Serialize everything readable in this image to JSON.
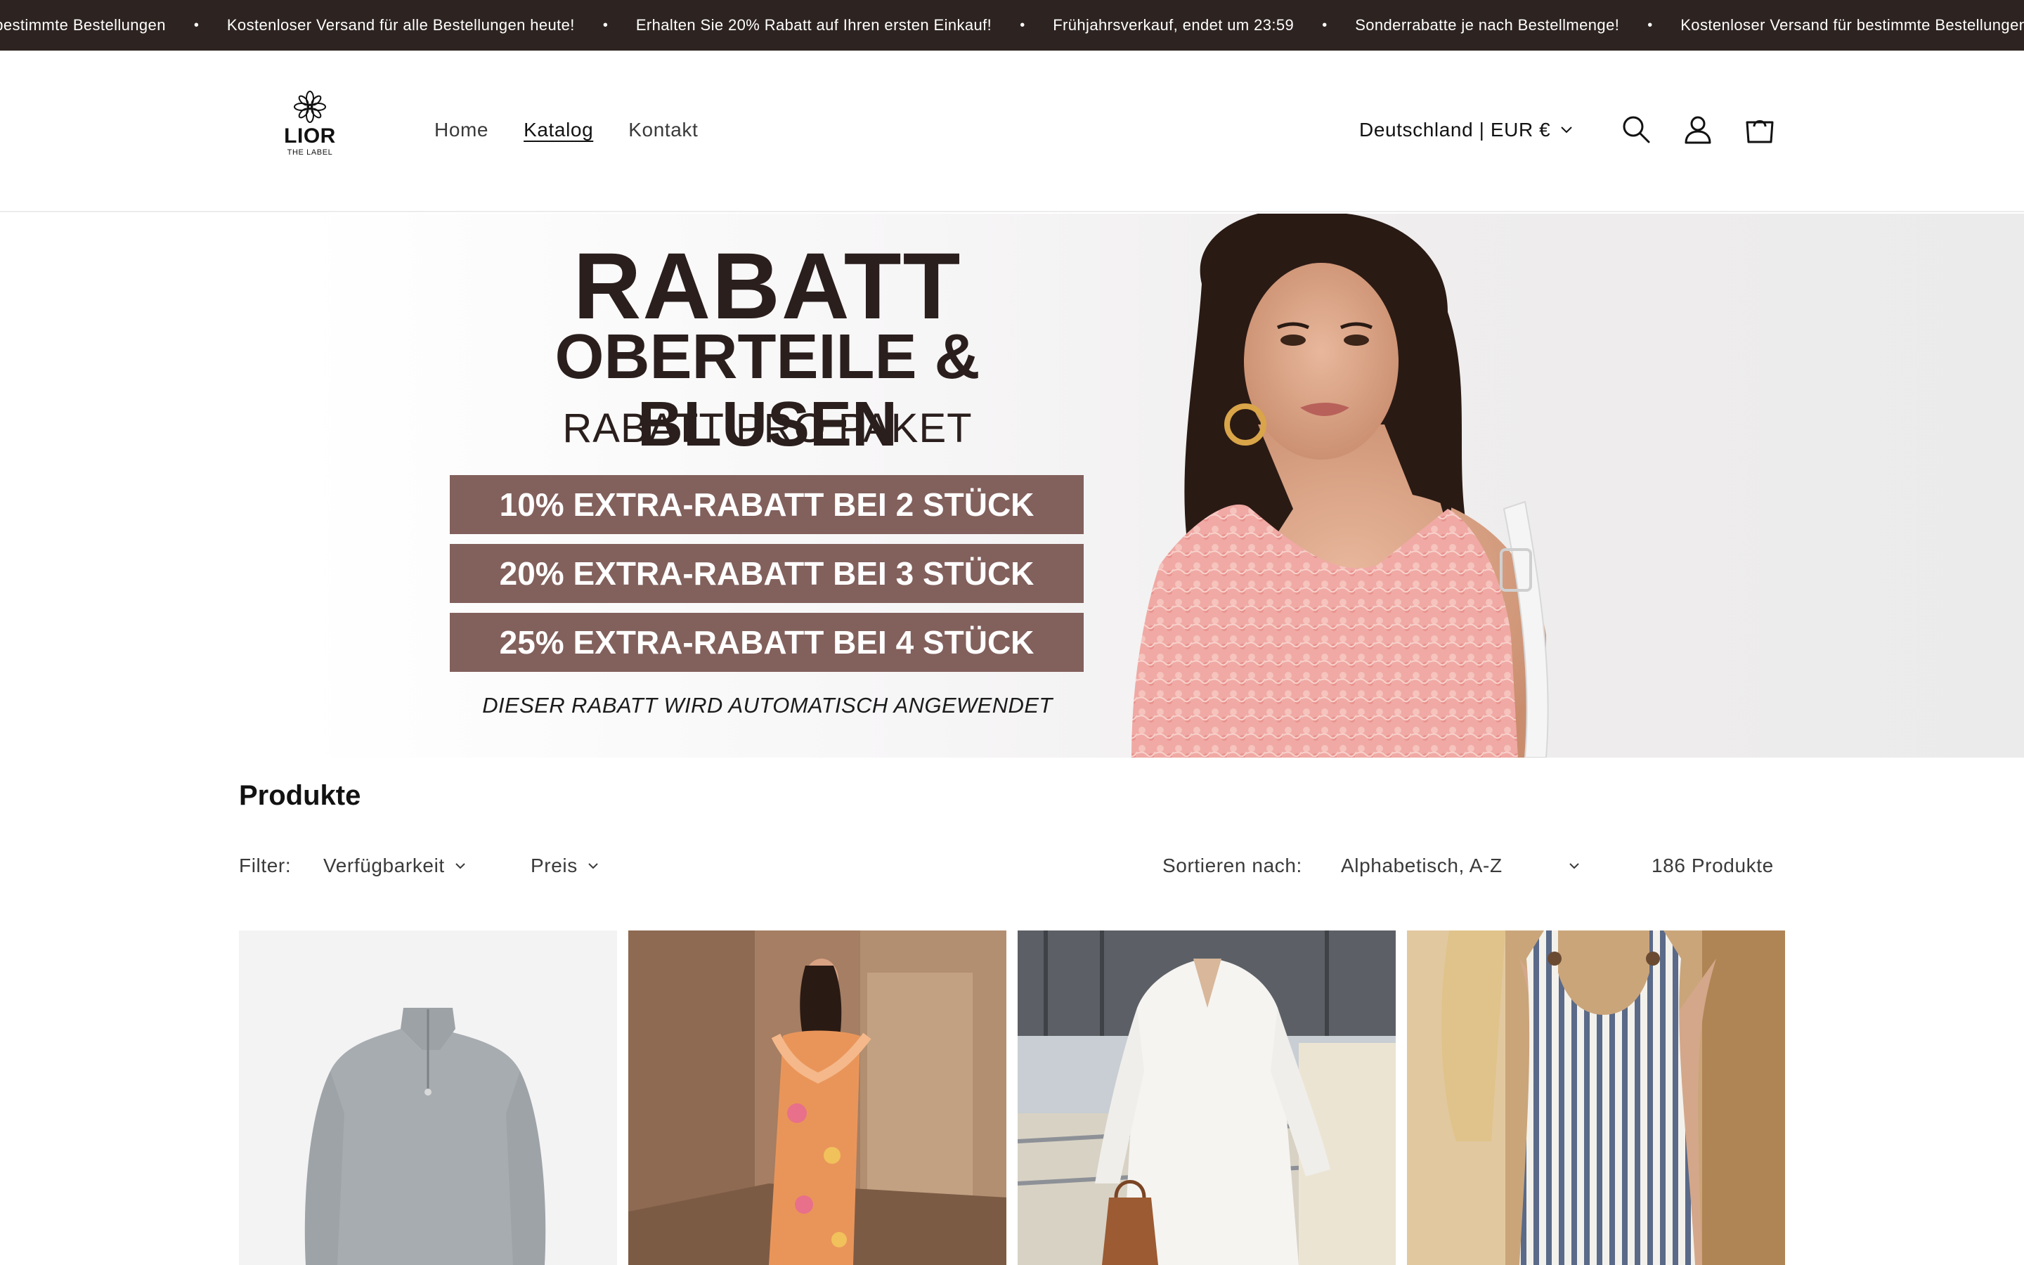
{
  "announcement": {
    "items": [
      "r bestimmte Bestellungen",
      "Kostenloser Versand für alle Bestellungen heute!",
      "Erhalten Sie 20% Rabatt auf Ihren ersten Einkauf!",
      "Frühjahrsverkauf, endet um 23:59",
      "Sonderrabatte je nach Bestellmenge!",
      "Kostenloser Versand für bestimmte Bestellungen"
    ],
    "separator": "•",
    "background": "#2d2421"
  },
  "header": {
    "logo": {
      "main": "LIOR",
      "sub": "THE LABEL",
      "icon": "flower-logo-icon"
    },
    "nav": [
      {
        "label": "Home",
        "active": false
      },
      {
        "label": "Katalog",
        "active": true
      },
      {
        "label": "Kontakt",
        "active": false
      }
    ],
    "locale": "Deutschland | EUR €",
    "icons": [
      "search-icon",
      "account-icon",
      "cart-icon"
    ]
  },
  "banner": {
    "title": "RABATT",
    "subtitle": "OBERTEILE & BLUSEN",
    "pack": "RABATT PRO PAKET",
    "offers": [
      "10% EXTRA-RABATT BEI 2 STÜCK",
      "20% EXTRA-RABATT BEI 3 STÜCK",
      "25% EXTRA-RABATT BEI 4 STÜCK"
    ],
    "note": "DIESER RABATT WIRD AUTOMATISCH ANGEWENDET",
    "accent": "#82605c",
    "text_color": "#2a1f1d"
  },
  "products": {
    "title": "Produkte",
    "filter_label": "Filter:",
    "filters": [
      "Verfügbarkeit",
      "Preis"
    ],
    "sort_label": "Sortieren nach:",
    "sort_value": "Alphabetisch, A-Z",
    "count": "186 Produkte",
    "cards": [
      {
        "image": "grey-zip-sweater"
      },
      {
        "image": "orange-floral-ruffle-dress"
      },
      {
        "image": "white-lace-dress"
      },
      {
        "image": "blue-striped-dress"
      }
    ]
  }
}
